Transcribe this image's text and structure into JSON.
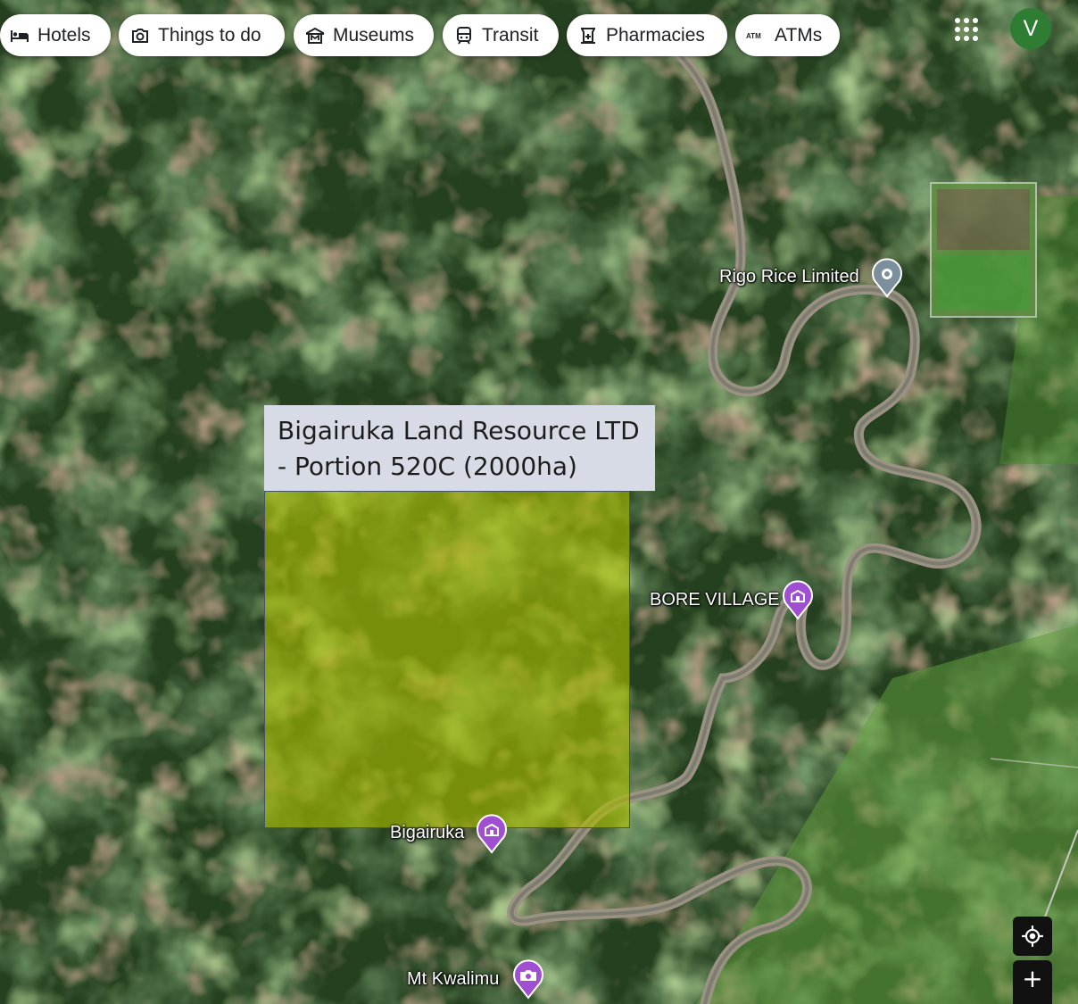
{
  "chips": [
    {
      "label": "Hotels",
      "icon": "bed-icon"
    },
    {
      "label": "Things to do",
      "icon": "camera-icon"
    },
    {
      "label": "Museums",
      "icon": "museum-icon"
    },
    {
      "label": "Transit",
      "icon": "train-icon"
    },
    {
      "label": "Pharmacies",
      "icon": "pharmacy-icon"
    },
    {
      "label": "ATMs",
      "icon": "atm-icon"
    }
  ],
  "account": {
    "avatar_letter": "V",
    "avatar_color": "#2e7d32"
  },
  "overlay": {
    "callout_text": "Bigairuka Land Resource LTD - Portion 520C (2000ha)",
    "parcel_fill": "#aabe00"
  },
  "places": [
    {
      "name": "Rigo Rice Limited",
      "icon": "place-pin-icon",
      "color": "#7b8f9c"
    },
    {
      "name": "BORE VILLAGE",
      "icon": "village-pin-icon",
      "color": "#a14fd2"
    },
    {
      "name": "Bigairuka",
      "icon": "village-pin-icon",
      "color": "#a14fd2"
    },
    {
      "name": "Mt Kwalimu",
      "icon": "camera-pin-icon",
      "color": "#a14fd2"
    }
  ],
  "controls": {
    "locate": "my-location-icon",
    "zoom_in": "+"
  }
}
